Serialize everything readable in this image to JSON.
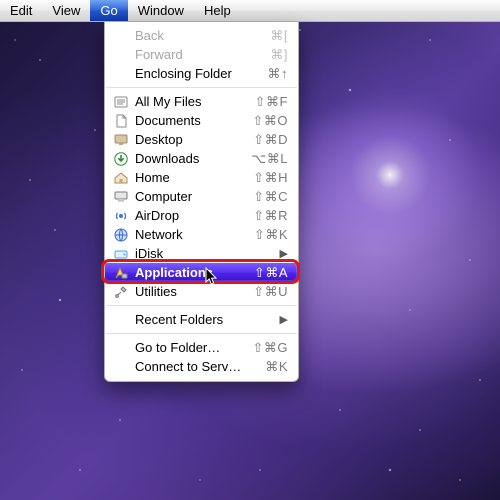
{
  "menubar": {
    "items": [
      {
        "label": "Edit"
      },
      {
        "label": "View"
      },
      {
        "label": "Go",
        "active": true
      },
      {
        "label": "Window"
      },
      {
        "label": "Help"
      }
    ]
  },
  "go_menu": {
    "back": {
      "label": "Back",
      "shortcut": "⌘["
    },
    "forward": {
      "label": "Forward",
      "shortcut": "⌘]"
    },
    "enclosing": {
      "label": "Enclosing Folder",
      "shortcut": "⌘↑"
    },
    "all_my_files": {
      "label": "All My Files",
      "shortcut": "⇧⌘F"
    },
    "documents": {
      "label": "Documents",
      "shortcut": "⇧⌘O"
    },
    "desktop": {
      "label": "Desktop",
      "shortcut": "⇧⌘D"
    },
    "downloads": {
      "label": "Downloads",
      "shortcut": "⌥⌘L"
    },
    "home": {
      "label": "Home",
      "shortcut": "⇧⌘H"
    },
    "computer": {
      "label": "Computer",
      "shortcut": "⇧⌘C"
    },
    "airdrop": {
      "label": "AirDrop",
      "shortcut": "⇧⌘R"
    },
    "network": {
      "label": "Network",
      "shortcut": "⇧⌘K"
    },
    "idisk": {
      "label": "iDisk",
      "submenu": true
    },
    "applications": {
      "label": "Applications",
      "shortcut": "⇧⌘A",
      "highlighted": true
    },
    "utilities": {
      "label": "Utilities",
      "shortcut": "⇧⌘U"
    },
    "recent": {
      "label": "Recent Folders",
      "submenu": true
    },
    "go_to_folder": {
      "label": "Go to Folder…",
      "shortcut": "⇧⌘G"
    },
    "connect": {
      "label": "Connect to Server…",
      "shortcut": "⌘K"
    }
  },
  "colors": {
    "menubar_active_top": "#6fa6f2",
    "menubar_active_bottom": "#0e3aa9",
    "highlight_top": "#7a5cff",
    "highlight_bottom": "#3a12c8",
    "annotation": "#e21616"
  }
}
